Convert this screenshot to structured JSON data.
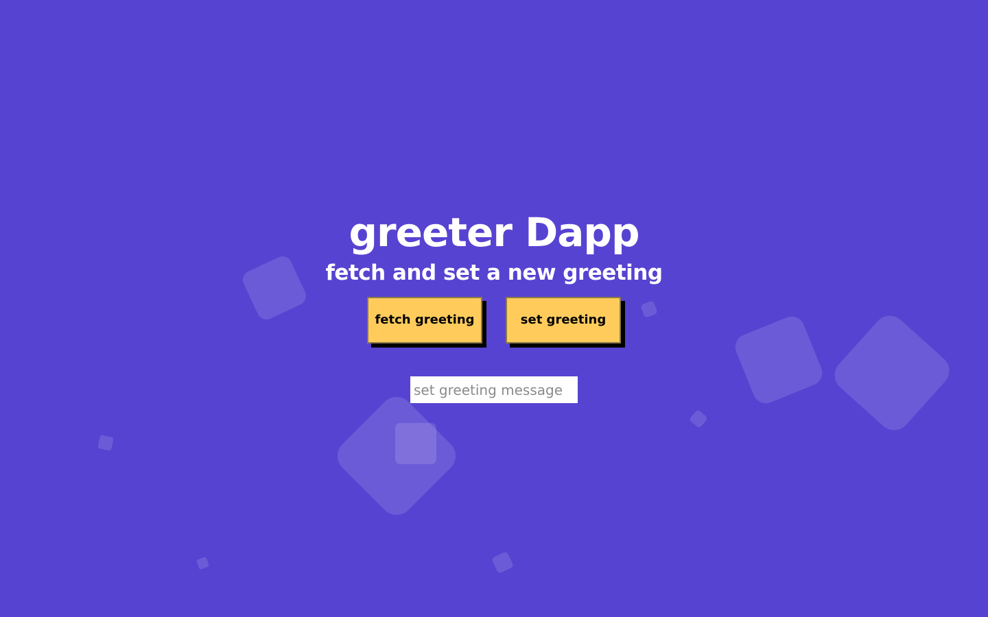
{
  "page": {
    "title": "greeter Dapp",
    "subtitle": "fetch and set a new greeting"
  },
  "actions": {
    "fetch_label": "fetch greeting",
    "set_label": "set greeting"
  },
  "greeting_input": {
    "value": "",
    "placeholder": "set greeting message"
  },
  "colors": {
    "background": "#5743d1",
    "button": "#ffcc5c",
    "button_shadow": "#000000",
    "text": "#ffffff"
  }
}
